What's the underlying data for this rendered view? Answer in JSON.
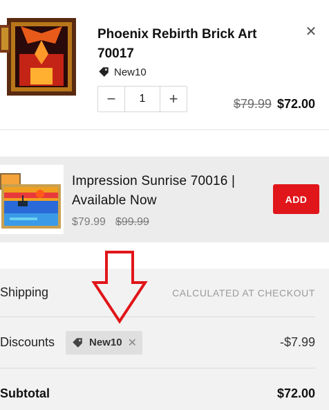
{
  "cart_item": {
    "title": "Phoenix Rebirth Brick Art 70017",
    "code": "New10",
    "code_icon": "tag-icon",
    "quantity": "1",
    "price_original": "$79.99",
    "price_final": "$72.00",
    "remove_icon": "close-icon",
    "qty_minus": "−",
    "qty_plus": "+",
    "remove_glyph": "✕"
  },
  "upsell": {
    "title": "Impression Sunrise 70016 | Available Now",
    "price_sale": "$79.99",
    "price_compare": "$99.99",
    "add_label": "ADD"
  },
  "summary": {
    "shipping_label": "Shipping",
    "shipping_note": "CALCULATED AT CHECKOUT",
    "discounts_label": "Discounts",
    "discount_code": "New10",
    "discount_remove": "✕",
    "discount_value": "-$7.99",
    "subtotal_label": "Subtotal",
    "subtotal_value": "$72.00"
  },
  "colors": {
    "accent": "#e0161a",
    "arrow": "#e0161a",
    "summary_bg": "#f2f2f2",
    "upsell_bg": "#ececec"
  }
}
